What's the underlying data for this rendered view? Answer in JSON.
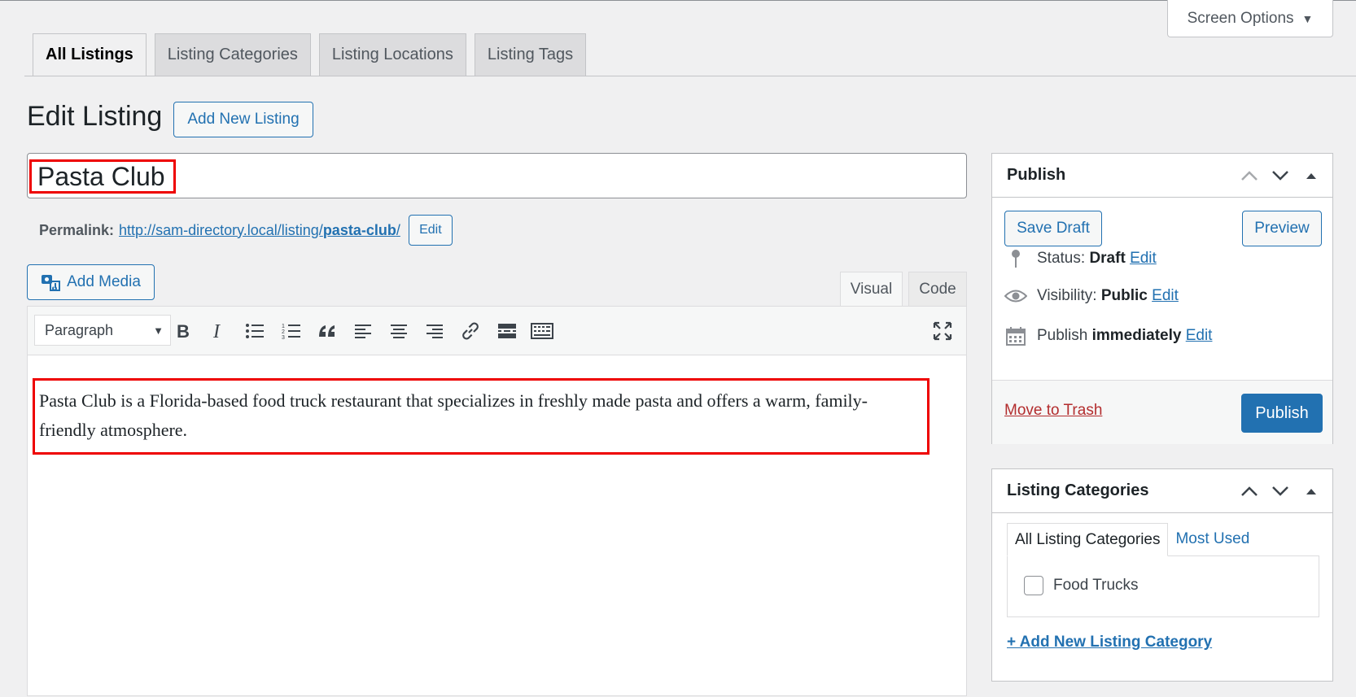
{
  "screen_options": {
    "label": "Screen Options"
  },
  "tabs": [
    {
      "label": "All Listings",
      "active": true
    },
    {
      "label": "Listing Categories",
      "active": false
    },
    {
      "label": "Listing Locations",
      "active": false
    },
    {
      "label": "Listing Tags",
      "active": false
    }
  ],
  "page": {
    "title": "Edit Listing",
    "add_new_label": "Add New Listing"
  },
  "post": {
    "title": "Pasta Club",
    "permalink_label": "Permalink:",
    "permalink_base": "http://sam-directory.local/listing/",
    "permalink_slug": "pasta-club",
    "permalink_trailing": "/",
    "permalink_edit": "Edit"
  },
  "editor": {
    "add_media_label": "Add Media",
    "mode_visual": "Visual",
    "mode_code": "Code",
    "format": "Paragraph",
    "content": "Pasta Club is a Florida-based food truck restaurant that specializes in freshly made pasta and offers a warm, family-friendly atmosphere."
  },
  "publish": {
    "title": "Publish",
    "save_draft": "Save Draft",
    "preview": "Preview",
    "status_label": "Status:",
    "status_value": "Draft",
    "visibility_label": "Visibility:",
    "visibility_value": "Public",
    "publish_label": "Publish",
    "publish_value": "immediately",
    "edit": "Edit",
    "trash": "Move to Trash",
    "publish_button": "Publish"
  },
  "categories": {
    "title": "Listing Categories",
    "tab_all": "All Listing Categories",
    "tab_most_used": "Most Used",
    "items": [
      {
        "label": "Food Trucks",
        "checked": false
      }
    ],
    "add_new": "+ Add New Listing Category"
  },
  "colors": {
    "accent": "#2271b1",
    "highlight": "#ee0000",
    "trash": "#b32d2e",
    "background": "#f0f0f1"
  }
}
